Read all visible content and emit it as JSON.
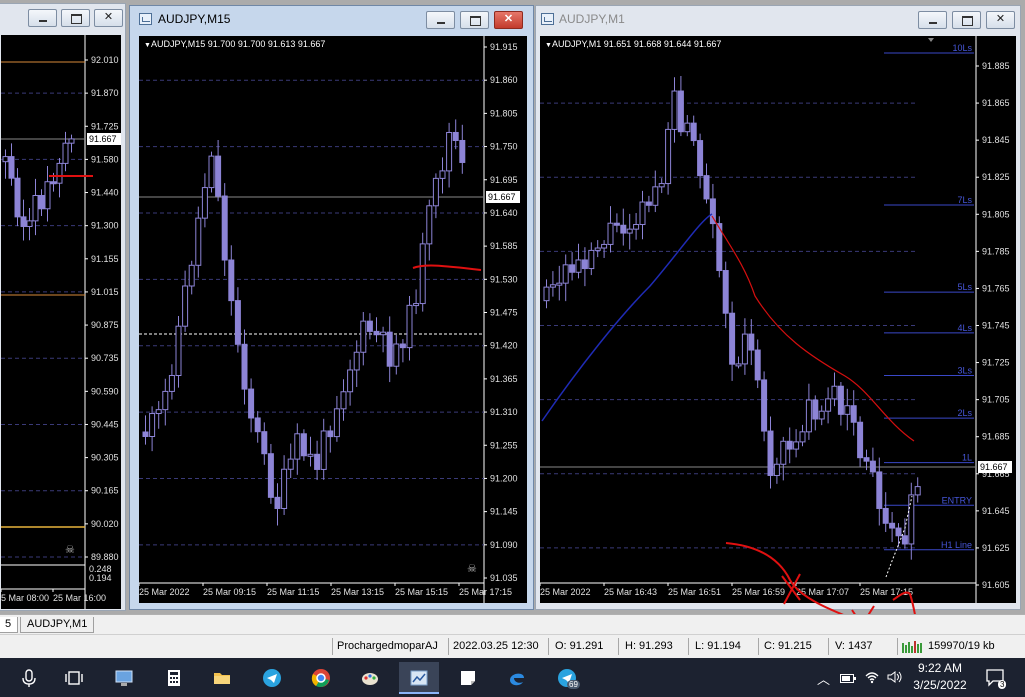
{
  "colors": {
    "bullish": "#8d84d6",
    "bearish": "#8d84d6",
    "grid": "#3a3a78",
    "ma_blue": "#1f2bb5",
    "ma_red": "#d40f0f",
    "level_line": "#3a48c8",
    "level_label": "#4656d8",
    "axis_text": "#e0e0e0",
    "annotation_red": "#e01010",
    "price_box_bg": "#ffffff"
  },
  "windows": {
    "left": {
      "title": "",
      "chart": {
        "price_labels": [
          "92.010",
          "91.870",
          "91.725",
          "91.580",
          "91.440",
          "91.300",
          "91.155",
          "91.015",
          "90.875",
          "90.735",
          "90.590",
          "90.445",
          "90.305",
          "90.165",
          "90.020",
          "89.880"
        ],
        "current_price": "91.667",
        "subwindow_labels": [
          "0.248",
          "0.194"
        ],
        "time_labels": [
          "5 Mar 08:00",
          "25 Mar 16:00"
        ],
        "icon": "skull-icon"
      }
    },
    "m15": {
      "title": "AUDJPY,M15",
      "info": "AUDJPY,M15  91.700 91.700 91.613 91.667",
      "chart": {
        "price_labels": [
          "91.915",
          "91.860",
          "91.805",
          "91.750",
          "91.695",
          "91.640",
          "91.585",
          "91.530",
          "91.475",
          "91.420",
          "91.365",
          "91.310",
          "91.255",
          "91.200",
          "91.145",
          "91.090",
          "91.035"
        ],
        "current_price": "91.667",
        "time_labels": [
          "25 Mar 2022",
          "25 Mar 09:15",
          "25 Mar 11:15",
          "25 Mar 13:15",
          "25 Mar 15:15",
          "25 Mar 17:15"
        ],
        "icon": "skull-icon"
      }
    },
    "m1": {
      "title": "AUDJPY,M1",
      "info": "AUDJPY,M1  91.651 91.668 91.644 91.667",
      "chart": {
        "price_labels": [
          "91.885",
          "91.865",
          "91.845",
          "91.825",
          "91.805",
          "91.785",
          "91.765",
          "91.745",
          "91.725",
          "91.705",
          "91.685",
          "91.665",
          "91.645",
          "91.625",
          "91.605"
        ],
        "current_price": "91.667",
        "time_labels": [
          "25 Mar 2022",
          "25 Mar 16:43",
          "25 Mar 16:51",
          "25 Mar 16:59",
          "25 Mar 17:07",
          "25 Mar 17:15"
        ],
        "levels": [
          {
            "label": "10Ls",
            "price": 91.892
          },
          {
            "label": "7Ls",
            "price": 91.81
          },
          {
            "label": "5Ls",
            "price": 91.763
          },
          {
            "label": "4Ls",
            "price": 91.741
          },
          {
            "label": "3Ls",
            "price": 91.718
          },
          {
            "label": "2Ls",
            "price": 91.695
          },
          {
            "label": "1L",
            "price": 91.671
          },
          {
            "label": "ENTRY",
            "price": 91.648
          },
          {
            "label": "H1 Line",
            "price": 91.624
          }
        ]
      }
    }
  },
  "bottom_tabs": [
    "5",
    "AUDJPY,M1"
  ],
  "status": {
    "profile": "ProchargedmoparAJ",
    "datetime": "2022.03.25 12:30",
    "open": "O: 91.291",
    "high": "H: 91.293",
    "low": "L: 91.194",
    "close": "C: 91.215",
    "volume": "V: 1437",
    "traffic": "159970/19 kb"
  },
  "taskbar": {
    "apps": [
      "microphone-icon",
      "task-view-icon",
      "computer-icon",
      "calculator-icon",
      "file-explorer-icon",
      "telegram-icon",
      "chrome-icon",
      "paint-icon",
      "metatrader-icon",
      "sticky-notes-icon",
      "edge-icon",
      "telegram-desktop-icon"
    ],
    "badge": "69",
    "time": "9:22 AM",
    "date": "3/25/2022",
    "notification_count": "3"
  }
}
